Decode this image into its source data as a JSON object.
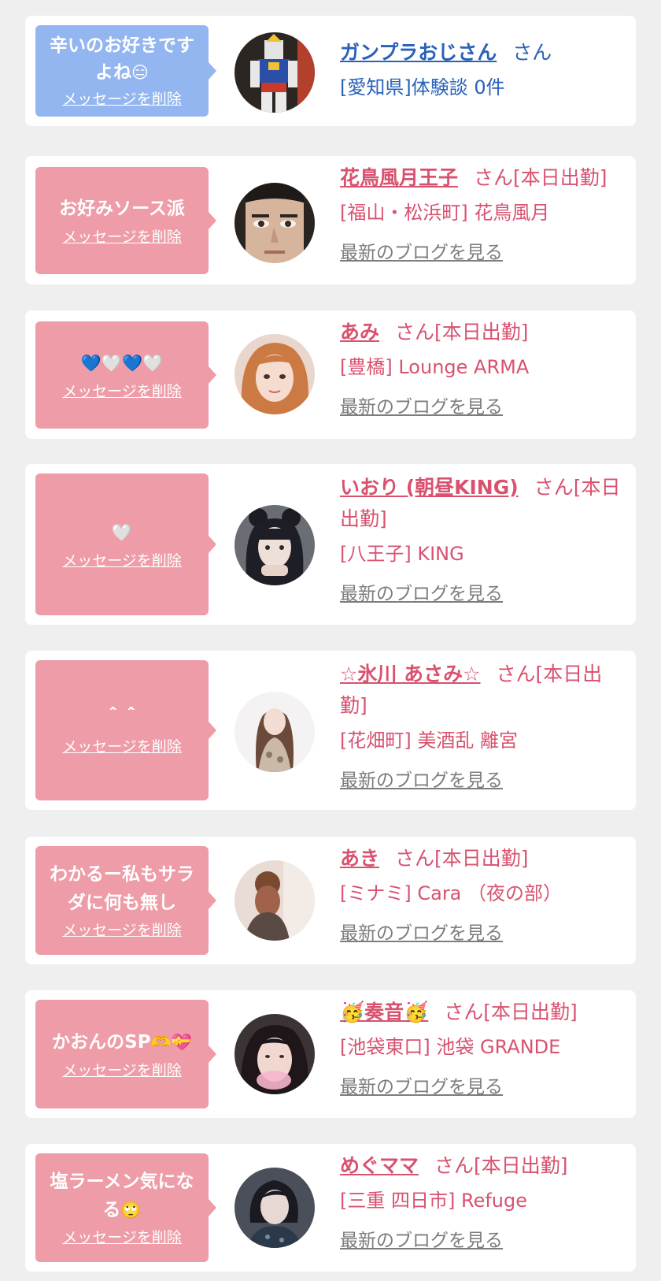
{
  "favorites": [
    {
      "message": "辛いのお好きですよね",
      "message_emoji": "😑",
      "delete_label": "メッセージを削除",
      "name": "ガンプラおじさん",
      "name_suffix": "さん",
      "shop": "[愛知県]体験談 0件",
      "blog_label": "",
      "theme": "blue",
      "avatar_icon": "gundam-figure-avatar"
    },
    {
      "message": "お好みソース派",
      "message_emoji": "",
      "delete_label": "メッセージを削除",
      "name": "花鳥風月王子",
      "name_suffix": "さん[本日出勤]",
      "shop": "[福山・松浜町] 花鳥風月",
      "blog_label": "最新のブログを見る",
      "theme": "pink",
      "avatar_icon": "man-face-avatar"
    },
    {
      "message": "💙🤍💙🤍",
      "message_emoji": "",
      "delete_label": "メッセージを削除",
      "name": "あみ",
      "name_suffix": "さん[本日出勤]",
      "shop": "[豊橋] Lounge ARMA",
      "blog_label": "最新のブログを見る",
      "theme": "pink",
      "avatar_icon": "woman-orange-hair-avatar"
    },
    {
      "message": "🤍",
      "message_emoji": "",
      "delete_label": "メッセージを削除",
      "name": "いおり (朝昼KING)",
      "name_suffix": "さん[本日出勤]",
      "shop": "[八王子] KING",
      "blog_label": "最新のブログを見る",
      "theme": "pink",
      "avatar_icon": "woman-dark-hair-avatar"
    },
    {
      "message": "＾＾",
      "message_emoji": "",
      "delete_label": "メッセージを削除",
      "name": "☆氷川 あさみ☆",
      "name_suffix": "さん[本日出勤]",
      "shop": "[花畑町] 美酒乱 離宮",
      "blog_label": "最新のブログを見る",
      "theme": "pink",
      "avatar_icon": "woman-dress-avatar"
    },
    {
      "message": "わかるー私もサラダに何も無し",
      "message_emoji": "",
      "delete_label": "メッセージを削除",
      "name": "あき",
      "name_suffix": "さん[本日出勤]",
      "shop": "[ミナミ] Cara （夜の部）",
      "blog_label": "最新のブログを見る",
      "theme": "pink",
      "avatar_icon": "woman-updo-avatar"
    },
    {
      "message": "かおんのSP",
      "message_emoji": "🫶💝",
      "delete_label": "メッセージを削除",
      "name": "🥳奏音🥳",
      "name_suffix": "さん[本日出勤]",
      "shop": "[池袋東口] 池袋 GRANDE",
      "blog_label": "最新のブログを見る",
      "theme": "pink",
      "avatar_icon": "woman-selfie-avatar"
    },
    {
      "message": "塩ラーメン気になる",
      "message_emoji": "🙄",
      "delete_label": "メッセージを削除",
      "name": "めぐママ",
      "name_suffix": "さん[本日出勤]",
      "shop": "[三重 四日市] Refuge",
      "blog_label": "最新のブログを見る",
      "theme": "pink",
      "avatar_icon": "woman-short-hair-avatar"
    }
  ]
}
